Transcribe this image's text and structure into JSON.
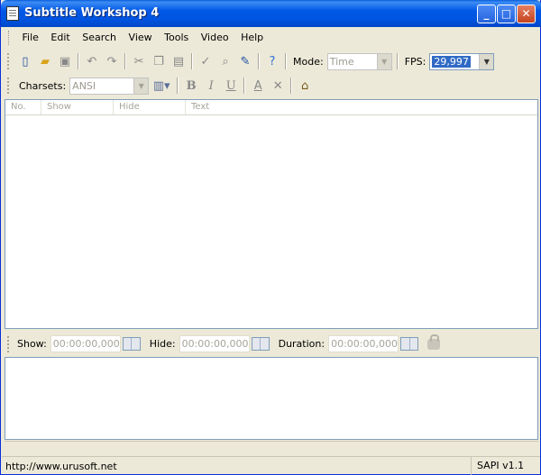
{
  "window": {
    "title": "Subtitle Workshop 4"
  },
  "menu": [
    "File",
    "Edit",
    "Search",
    "View",
    "Tools",
    "Video",
    "Help"
  ],
  "toolbar": {
    "mode_label": "Mode:",
    "mode_value": "Time",
    "fps_label": "FPS:",
    "fps_value": "29,997"
  },
  "charset_toolbar": {
    "charsets_label": "Charsets:",
    "charset_value": "ANSI",
    "bold": "B",
    "italic": "I",
    "underline": "U",
    "font_color": "A"
  },
  "list": {
    "columns": [
      "No.",
      "Show",
      "Hide",
      "Text"
    ]
  },
  "timing": {
    "show_label": "Show:",
    "show_value": "00:00:00,000",
    "hide_label": "Hide:",
    "hide_value": "00:00:00,000",
    "duration_label": "Duration:",
    "duration_value": "00:00:00,000"
  },
  "status": {
    "url": "http://www.urusoft.net",
    "sapi": "SAPI v1.1"
  }
}
